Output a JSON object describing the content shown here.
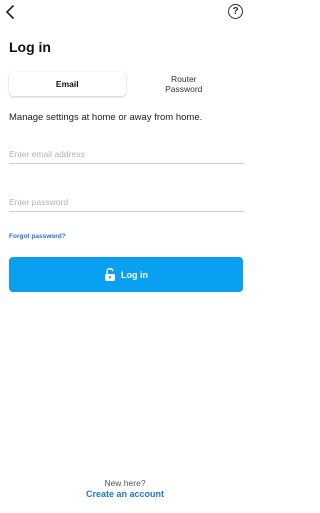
{
  "header": {
    "back_icon": "chevron-left-icon",
    "help_icon": "question-circle-icon",
    "help_glyph": "?",
    "title": "Log in"
  },
  "tabs": [
    {
      "label": "Email",
      "active": true
    },
    {
      "label": "Router\nPassword",
      "active": false
    }
  ],
  "subtitle": "Manage settings at home or away from home.",
  "form": {
    "email_value": "",
    "email_placeholder": "Enter email address",
    "password_value": "",
    "password_placeholder": "Enter password",
    "forgot_label": "Forgot password?"
  },
  "login_button": {
    "label": "Log in",
    "icon": "unlocked-padlock-icon"
  },
  "footer": {
    "hint": "New here?",
    "create_label": "Create an account"
  },
  "colors": {
    "primary_button": "#0aa0f2",
    "link": "#2a6fd6"
  }
}
